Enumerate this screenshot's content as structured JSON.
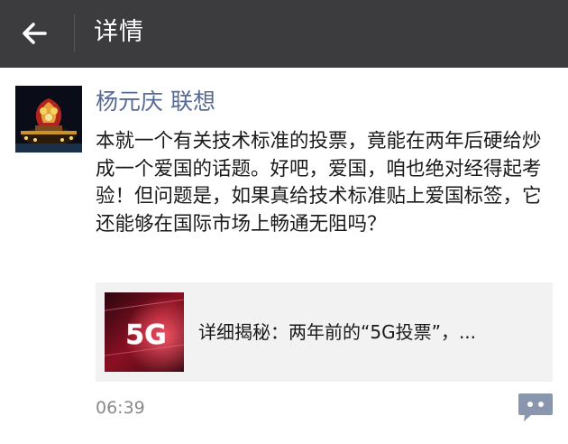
{
  "header": {
    "back_icon": "arrow-left-icon",
    "title": "详情"
  },
  "post": {
    "avatar_icon": "lantern-display-avatar",
    "author": "杨元庆 联想",
    "text": "本就一个有关技术标准的投票，竟能在两年后硬给炒成一个爱国的话题。好吧，爱国，咱也绝对经得起考验！但问题是，如果真给技术标准贴上爱国标签，它还能够在国际市场上畅通无阻吗？",
    "link": {
      "thumbnail_text": "5G",
      "title": "详细揭秘：两年前的“5G投票”，..."
    },
    "time": "06:39",
    "comment_icon": "comment-bubble-icon"
  },
  "colors": {
    "header_bg": "#3c3c3e",
    "author_link": "#576b95",
    "card_bg": "#f2f2f2",
    "time_text": "#8a8a8a",
    "comment_icon": "#8996ad"
  }
}
